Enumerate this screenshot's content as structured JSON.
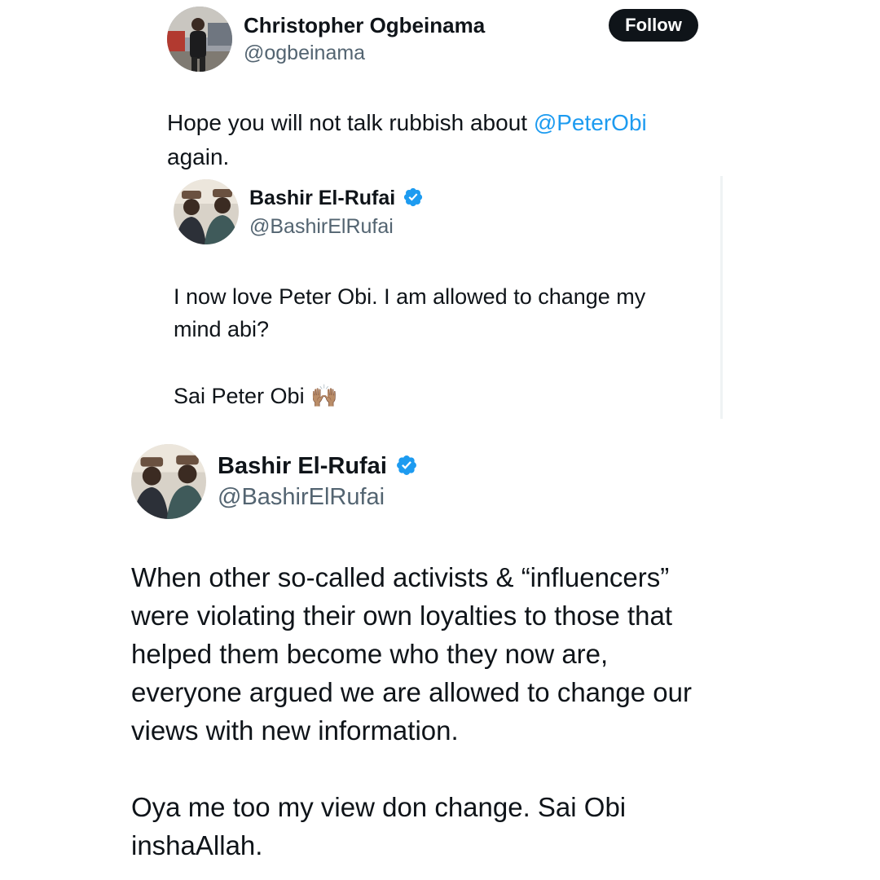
{
  "tweet1": {
    "author_name": "Christopher Ogbeinama",
    "author_handle": "@ogbeinama",
    "follow_label": "Follow",
    "text_before": "Hope you will not talk rubbish about ",
    "mention": "@PeterObi",
    "text_after": "again."
  },
  "quoted": {
    "author_name": "Bashir El-Rufai",
    "author_handle": "@BashirElRufai",
    "line1": "I now love Peter Obi. I am allowed to change my",
    "line2": "mind abi?",
    "line3": "Sai Peter Obi 🙌🏽"
  },
  "tweet2": {
    "author_name": "Bashir El-Rufai",
    "author_handle": "@BashirElRufai",
    "lines": [
      "When other so-called activists & “influencers”",
      "were violating their own loyalties to those that",
      "helped them become who they now are,",
      "everyone argued we are allowed to change our",
      "views with new information.",
      "",
      "Oya me too my view don change. Sai Obi",
      "inshaAllah."
    ]
  },
  "colors": {
    "verified": "#1d9bf0",
    "mention": "#1d9bf0",
    "follow_bg": "#0f1419"
  }
}
